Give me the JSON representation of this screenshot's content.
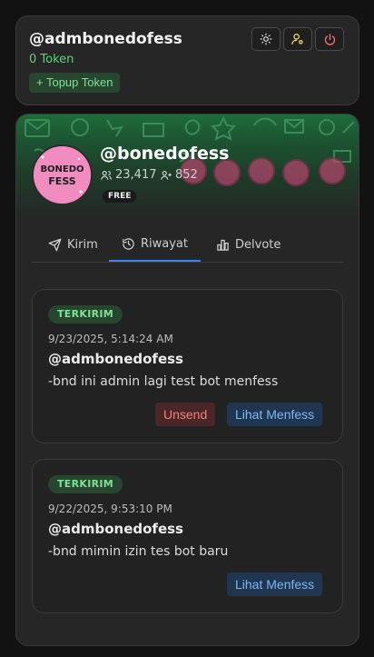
{
  "account": {
    "username": "@admbonedofess",
    "token_text": "0 Token",
    "topup_label": "+ Topup Token"
  },
  "profile": {
    "name": "@bonedofess",
    "followers": "23,417",
    "following": "852",
    "plan": "FREE",
    "avatar_text": "BONEDO FESS"
  },
  "tabs": [
    {
      "label": "Kirim"
    },
    {
      "label": "Riwayat"
    },
    {
      "label": "Delvote"
    }
  ],
  "active_tab": "Riwayat",
  "posts": [
    {
      "status": "TERKIRIM",
      "time": "9/23/2025, 5:14:24 AM",
      "user": "@admbonedofess",
      "text": "-bnd ini admin lagi test bot menfess",
      "unsend_label": "Unsend",
      "view_label": "Lihat Menfess"
    },
    {
      "status": "TERKIRIM",
      "time": "9/22/2025, 9:53:10 PM",
      "user": "@admbonedofess",
      "text": "-bnd mimin izin tes bot baru",
      "view_label": "Lihat Menfess"
    }
  ],
  "colors": {
    "accent": "#3b82f6",
    "success": "#5bd37a",
    "danger": "#f08080",
    "link": "#7cb8f5"
  }
}
